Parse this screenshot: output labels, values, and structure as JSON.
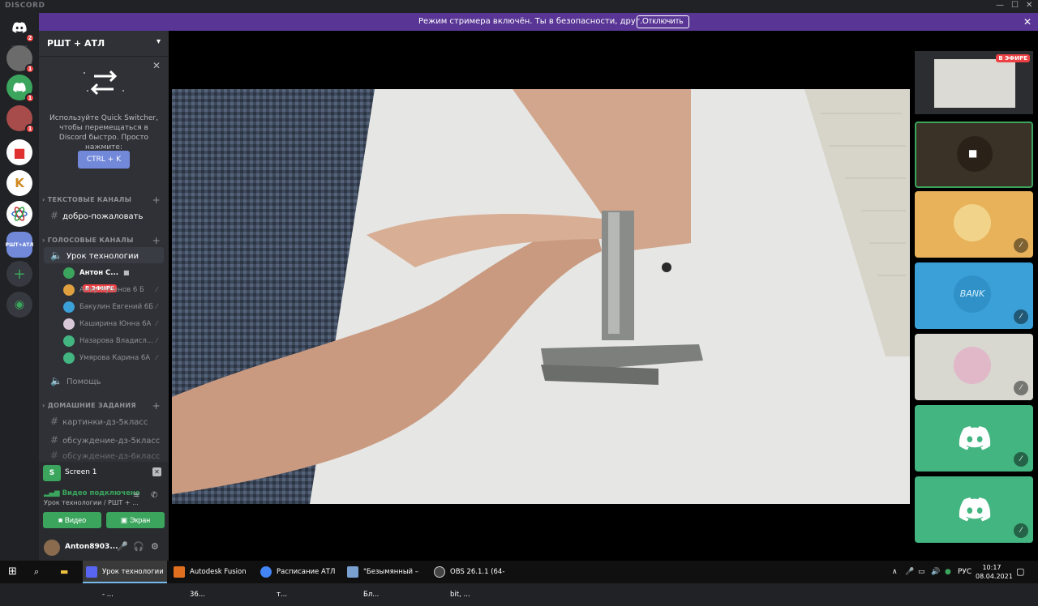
{
  "app": {
    "brand": "DISCORD"
  },
  "banner": {
    "message": "Режим стримера включён. Ты в безопасности, друг.",
    "button": "Отключить"
  },
  "guilds": [
    {
      "name": "home",
      "badge": "2",
      "color": "#5865f2"
    },
    {
      "name": "server-1",
      "badge": "1",
      "color": "#6b6b6b"
    },
    {
      "name": "server-2",
      "badge": "1",
      "color": "#3ba55d"
    },
    {
      "name": "server-3",
      "badge": "1",
      "color": "#a84b4b"
    },
    {
      "name": "server-4",
      "badge": "",
      "color": "#ffffff"
    },
    {
      "name": "server-5",
      "badge": "",
      "color": "#ffffff"
    },
    {
      "name": "server-6",
      "badge": "",
      "color": "#ffffff"
    },
    {
      "name": "current",
      "label": "РШТ+АТЛ",
      "badge": "",
      "color": "#7289da"
    }
  ],
  "server": {
    "name": "РШТ + АТЛ"
  },
  "quick_switcher": {
    "text": "Используйте Quick Switcher, чтобы перемещаться в Discord быстро. Просто нажмите:",
    "shortcut": "CTRL + K"
  },
  "categories": {
    "text": "ТЕКСТОВЫЕ КАНАЛЫ",
    "voice": "ГОЛОСОВЫЕ КАНАЛЫ",
    "homework": "ДОМАШНИЕ ЗАДАНИЯ"
  },
  "channels": {
    "welcome": "добро-пожаловать",
    "lesson": "Урок технологии",
    "help": "Помощь",
    "hw1": "картинки-дз-5класс",
    "hw2": "обсуждение-дз-5класс",
    "hw3": "обсуждение-дз-6класс"
  },
  "members": [
    {
      "name": "Антон С...",
      "live": "В ЭФИРЕ",
      "color": "#3ba55d"
    },
    {
      "name": "Амир Кубенов 6 Б",
      "color": "#e0a040"
    },
    {
      "name": "Бакулин Евгений 6Б",
      "color": "#3ca0d8"
    },
    {
      "name": "Каширина Юнна 6А",
      "color": "#d8c8d8"
    },
    {
      "name": "Назарова Владисл...",
      "color": "#43b581"
    },
    {
      "name": "Умярова Карина 6А",
      "color": "#43b581"
    }
  ],
  "panel": {
    "screen_label": "Screen 1",
    "screen_initial": "S",
    "connected": "Видео подключено",
    "location": "Урок технологии / РШТ + ...",
    "video_button": "Видео",
    "screen_button": "Экран"
  },
  "user": {
    "name": "Anton8903..."
  },
  "stage_tile": {
    "live": "В ЭФИРЕ"
  },
  "tiles": [
    {
      "name": "camera-tile",
      "bg": "#3a3226"
    },
    {
      "name": "tile-2",
      "bg": "#e8b25a"
    },
    {
      "name": "tile-3",
      "bg": "#3ca0d8",
      "label": "BANK"
    },
    {
      "name": "tile-4",
      "bg": "#d8d8d0"
    },
    {
      "name": "tile-5",
      "bg": "#43b581"
    },
    {
      "name": "tile-6",
      "bg": "#43b581"
    }
  ],
  "taskbar": {
    "tasks": [
      {
        "label": "Урок технологии - ...",
        "color": "#5865f2"
      },
      {
        "label": "Autodesk Fusion 36...",
        "color": "#e07020"
      },
      {
        "label": "Расписание АТЛ т...",
        "color": "#4285f4"
      },
      {
        "label": "\"Безымянный – Бл...",
        "color": "#7aa0d0"
      },
      {
        "label": "OBS 26.1.1 (64-bit, ...",
        "color": "#444444"
      }
    ],
    "lang": "РУС",
    "time": "10:17",
    "date": "08.04.2021"
  }
}
